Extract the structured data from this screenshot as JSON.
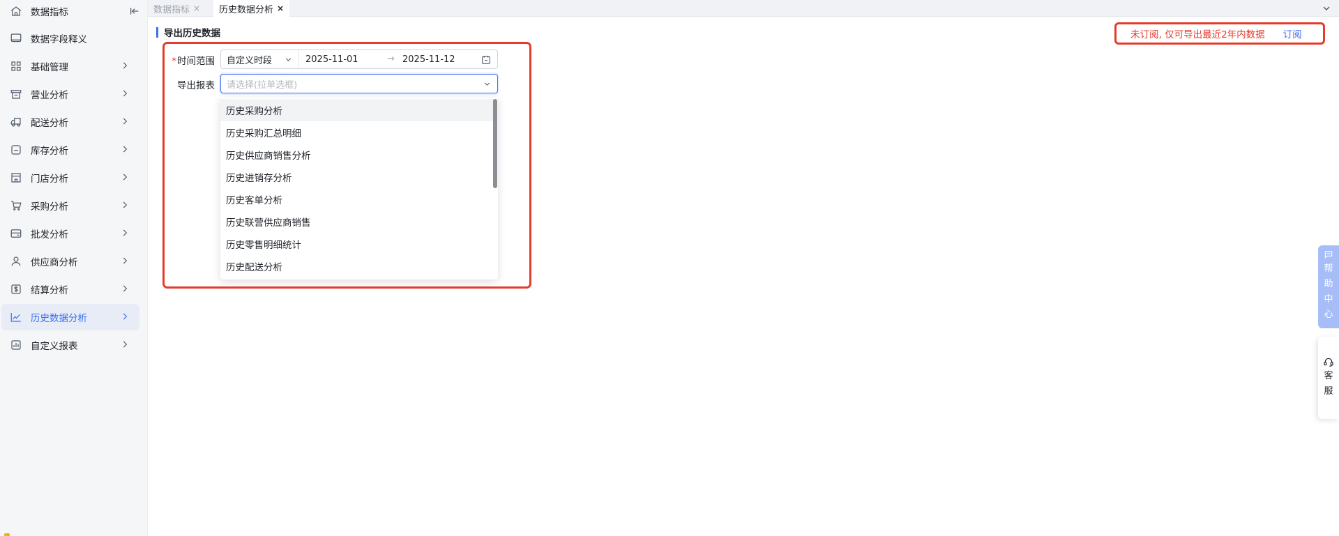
{
  "sidebar": {
    "items": [
      {
        "label": "数据指标",
        "icon": "home-icon",
        "has_arrow": false
      },
      {
        "label": "数据字段释义",
        "icon": "monitor-icon",
        "has_arrow": false
      },
      {
        "label": "基础管理",
        "icon": "grid-icon",
        "has_arrow": true
      },
      {
        "label": "营业分析",
        "icon": "shop-icon",
        "has_arrow": true
      },
      {
        "label": "配送分析",
        "icon": "truck-icon",
        "has_arrow": true
      },
      {
        "label": "库存分析",
        "icon": "warehouse-icon",
        "has_arrow": true
      },
      {
        "label": "门店分析",
        "icon": "store-icon",
        "has_arrow": true
      },
      {
        "label": "采购分析",
        "icon": "cart-icon",
        "has_arrow": true
      },
      {
        "label": "批发分析",
        "icon": "card-icon",
        "has_arrow": true
      },
      {
        "label": "供应商分析",
        "icon": "user-icon",
        "has_arrow": true
      },
      {
        "label": "结算分析",
        "icon": "dollar-icon",
        "has_arrow": true
      },
      {
        "label": "历史数据分析",
        "icon": "line-chart-icon",
        "has_arrow": true,
        "active": true
      },
      {
        "label": "自定义报表",
        "icon": "bar-chart-icon",
        "has_arrow": true
      }
    ]
  },
  "tabs": [
    {
      "label": "数据指标",
      "close": "×",
      "active": false
    },
    {
      "label": "历史数据分析",
      "close": "×",
      "active": true
    }
  ],
  "section": {
    "title": "导出历史数据"
  },
  "notice": {
    "text": "未订阅, 仅可导出最近2年内数据",
    "link": "订阅"
  },
  "form": {
    "time_range": {
      "required_mark": "*",
      "label": "时间范围",
      "mode": "自定义时段",
      "start": "2025-11-01",
      "separator": "→",
      "end": "2025-11-12"
    },
    "report": {
      "label": "导出报表",
      "placeholder": "请选择(拉单选框)"
    }
  },
  "dropdown": {
    "options": [
      "历史采购分析",
      "历史采购汇总明细",
      "历史供应商销售分析",
      "历史进销存分析",
      "历史客单分析",
      "历史联营供应商销售",
      "历史零售明细统计",
      "历史配送分析"
    ],
    "hovered_index": 0
  },
  "float": {
    "help": [
      "帮",
      "助",
      "中",
      "心"
    ],
    "service": [
      "客",
      "服"
    ]
  },
  "colors": {
    "accent": "#3b6ff5",
    "alert": "#e53b2b",
    "sidebar_bg": "#f5f6f7"
  }
}
